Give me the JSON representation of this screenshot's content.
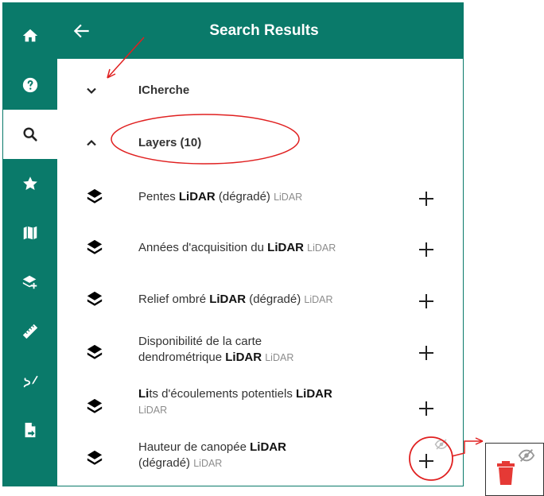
{
  "header": {
    "title": "Search Results",
    "back_icon": "arrow-left-icon"
  },
  "rail": {
    "items": [
      {
        "icon": "home-icon"
      },
      {
        "icon": "help-icon"
      },
      {
        "icon": "search-icon",
        "active": true
      },
      {
        "icon": "star-icon"
      },
      {
        "icon": "map-icon"
      },
      {
        "icon": "add-layer-icon"
      },
      {
        "icon": "ruler-icon"
      },
      {
        "icon": "draw-icon"
      },
      {
        "icon": "export-file-icon"
      }
    ]
  },
  "groups": [
    {
      "label": "ICherche",
      "state": "collapsed"
    },
    {
      "label": "Layers (10)",
      "state": "expanded"
    }
  ],
  "layers": [
    {
      "pre": "Pentes ",
      "bold": "LiDAR",
      "post": " (dégradé) ",
      "tag": "LiDAR"
    },
    {
      "pre": "Années d'acquisition du ",
      "bold": "LiDAR",
      "post": " ",
      "tag": "LiDAR"
    },
    {
      "pre": "Relief ombré ",
      "bold": "LiDAR",
      "post": " (dégradé) ",
      "tag": "LiDAR"
    },
    {
      "line1": "Disponibilité de la carte",
      "pre": "dendrométrique ",
      "bold": "LiDAR",
      "post": " ",
      "tag": "LiDAR"
    },
    {
      "line1_bold": "Li",
      "line1_rest": "ts d'écoulements potentiels ",
      "line1_bold2": "LiDAR",
      "tag": "LiDAR"
    },
    {
      "line1_pre": "Hauteur de canopée ",
      "line1_bold": "LiDAR",
      "line2_pre": "(dégradé) ",
      "tag": "LiDAR"
    }
  ],
  "icons": {
    "layer": "layers-icon",
    "add": "plus-icon",
    "visibility": "eye-off-icon",
    "delete": "trash-icon"
  },
  "colors": {
    "primary": "#0a7a6a",
    "annotation": "#e02020",
    "delete": "#e53935"
  }
}
